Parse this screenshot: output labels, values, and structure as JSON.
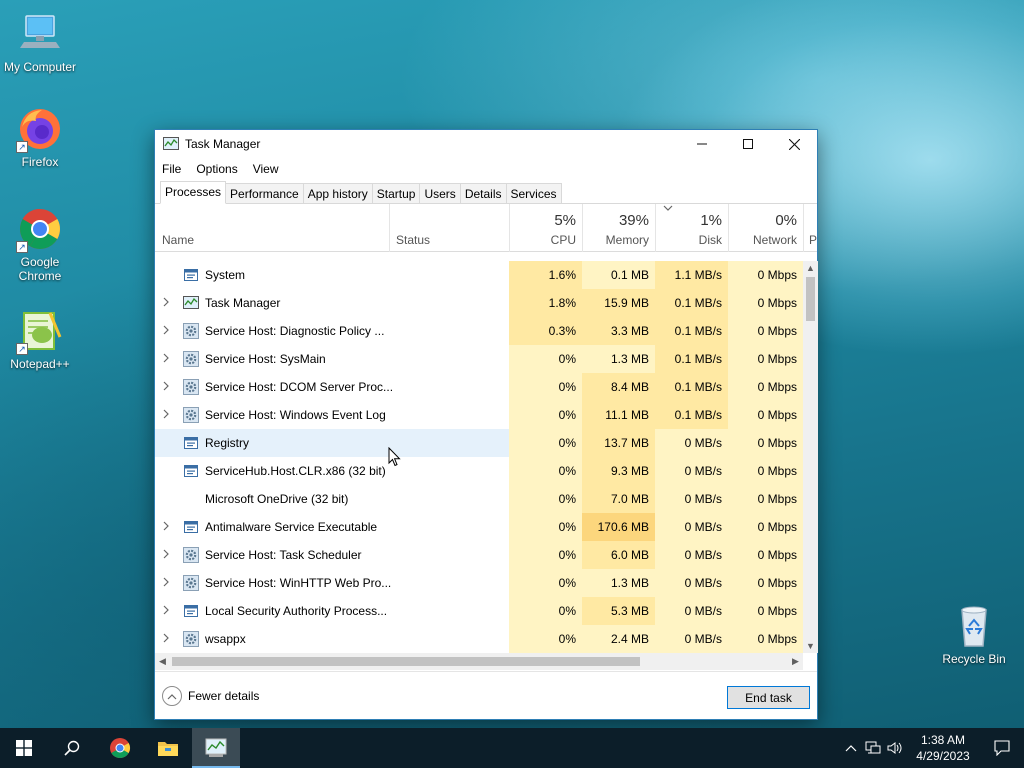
{
  "desktop": {
    "icons": [
      {
        "label": "My Computer"
      },
      {
        "label": "Firefox"
      },
      {
        "label": "Google Chrome"
      },
      {
        "label": "Notepad++"
      },
      {
        "label": "Recycle Bin"
      }
    ]
  },
  "window": {
    "title": "Task Manager",
    "controls": {
      "minimize": "—",
      "maximize": "☐",
      "close": "✕"
    },
    "menu": [
      "File",
      "Options",
      "View"
    ],
    "tabs": [
      "Processes",
      "Performance",
      "App history",
      "Startup",
      "Users",
      "Details",
      "Services"
    ],
    "active_tab": "Processes",
    "columns": {
      "name": "Name",
      "status": "Status",
      "cpu": {
        "pct": "5%",
        "label": "CPU"
      },
      "memory": {
        "pct": "39%",
        "label": "Memory"
      },
      "disk": {
        "pct": "1%",
        "label": "Disk"
      },
      "network": {
        "pct": "0%",
        "label": "Network"
      },
      "overflow": "P"
    },
    "processes": [
      {
        "name": "System",
        "expandable": false,
        "icon": "app-window-icon",
        "cpu": "1.6%",
        "memory": "0.1 MB",
        "disk": "1.1 MB/s",
        "network": "0 Mbps"
      },
      {
        "name": "Task Manager",
        "expandable": true,
        "icon": "task-manager-icon",
        "cpu": "1.8%",
        "memory": "15.9 MB",
        "disk": "0.1 MB/s",
        "network": "0 Mbps"
      },
      {
        "name": "Service Host: Diagnostic Policy ...",
        "expandable": true,
        "icon": "gear-icon",
        "cpu": "0.3%",
        "memory": "3.3 MB",
        "disk": "0.1 MB/s",
        "network": "0 Mbps"
      },
      {
        "name": "Service Host: SysMain",
        "expandable": true,
        "icon": "gear-icon",
        "cpu": "0%",
        "memory": "1.3 MB",
        "disk": "0.1 MB/s",
        "network": "0 Mbps"
      },
      {
        "name": "Service Host: DCOM Server Proc...",
        "expandable": true,
        "icon": "gear-icon",
        "cpu": "0%",
        "memory": "8.4 MB",
        "disk": "0.1 MB/s",
        "network": "0 Mbps"
      },
      {
        "name": "Service Host: Windows Event Log",
        "expandable": true,
        "icon": "gear-icon",
        "cpu": "0%",
        "memory": "11.1 MB",
        "disk": "0.1 MB/s",
        "network": "0 Mbps"
      },
      {
        "name": "Registry",
        "expandable": false,
        "icon": "app-window-icon",
        "cpu": "0%",
        "memory": "13.7 MB",
        "disk": "0 MB/s",
        "network": "0 Mbps"
      },
      {
        "name": "ServiceHub.Host.CLR.x86 (32 bit)",
        "expandable": false,
        "icon": "app-window-icon",
        "cpu": "0%",
        "memory": "9.3 MB",
        "disk": "0 MB/s",
        "network": "0 Mbps"
      },
      {
        "name": "Microsoft OneDrive (32 bit)",
        "expandable": false,
        "icon": "",
        "cpu": "0%",
        "memory": "7.0 MB",
        "disk": "0 MB/s",
        "network": "0 Mbps"
      },
      {
        "name": "Antimalware Service Executable",
        "expandable": true,
        "icon": "app-window-icon",
        "cpu": "0%",
        "memory": "170.6 MB",
        "disk": "0 MB/s",
        "network": "0 Mbps"
      },
      {
        "name": "Service Host: Task Scheduler",
        "expandable": true,
        "icon": "gear-icon",
        "cpu": "0%",
        "memory": "6.0 MB",
        "disk": "0 MB/s",
        "network": "0 Mbps"
      },
      {
        "name": "Service Host: WinHTTP Web Pro...",
        "expandable": true,
        "icon": "gear-icon",
        "cpu": "0%",
        "memory": "1.3 MB",
        "disk": "0 MB/s",
        "network": "0 Mbps"
      },
      {
        "name": "Local Security Authority Process...",
        "expandable": true,
        "icon": "app-window-icon",
        "cpu": "0%",
        "memory": "5.3 MB",
        "disk": "0 MB/s",
        "network": "0 Mbps"
      },
      {
        "name": "wsappx",
        "expandable": true,
        "icon": "gear-icon",
        "cpu": "0%",
        "memory": "2.4 MB",
        "disk": "0 MB/s",
        "network": "0 Mbps"
      }
    ],
    "footer": {
      "fewer_details": "Fewer details",
      "end_task": "End task"
    }
  },
  "colors": {
    "heat_light": "#fff4c4",
    "heat_medium": "#ffe9a3",
    "heat_strong": "#fcd67d",
    "accent": "#0078d7",
    "taskbar": "#0c1e29"
  },
  "taskbar": {
    "clock_time": "1:38 AM",
    "clock_date": "4/29/2023"
  }
}
